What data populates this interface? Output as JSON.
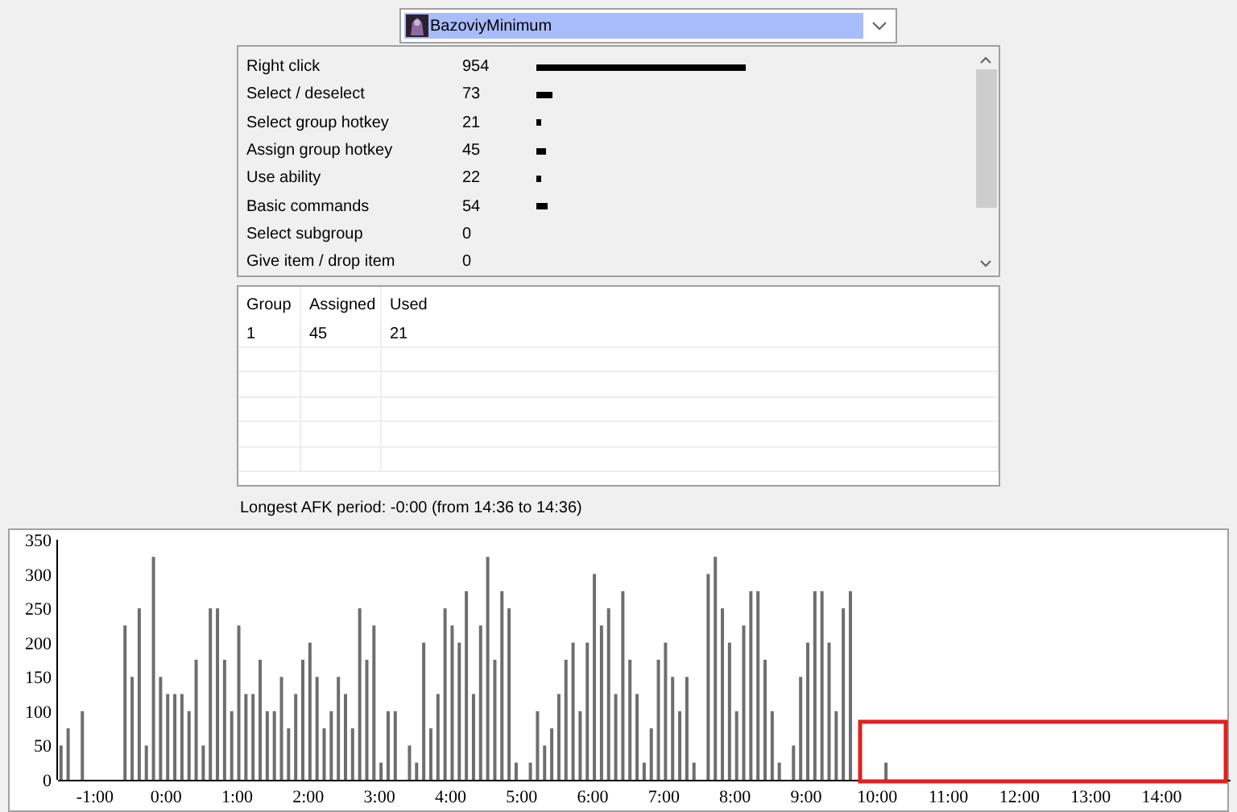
{
  "player_select": {
    "value": "BazoviyMinimum"
  },
  "actions": [
    {
      "label": "Right click",
      "count": "954"
    },
    {
      "label": "Select / deselect",
      "count": "73"
    },
    {
      "label": "Select group hotkey",
      "count": "21"
    },
    {
      "label": "Assign group hotkey",
      "count": "45"
    },
    {
      "label": "Use ability",
      "count": "22"
    },
    {
      "label": "Basic commands",
      "count": "54"
    },
    {
      "label": "Select subgroup",
      "count": "0"
    },
    {
      "label": "Give item / drop item",
      "count": "0"
    }
  ],
  "groups_table": {
    "columns": [
      "Group",
      "Assigned",
      "Used"
    ],
    "rows": [
      [
        "1",
        "45",
        "21"
      ]
    ]
  },
  "afk_text": "Longest AFK period: -0:00 (from 14:36 to 14:36)",
  "activity_chart": {
    "chart_data": {
      "type": "bar",
      "x": [
        -1.5,
        -1.4,
        -1.2,
        -0.6,
        -0.5,
        -0.4,
        -0.3,
        -0.2,
        -0.1,
        0.0,
        0.1,
        0.2,
        0.3,
        0.4,
        0.5,
        0.6,
        0.7,
        0.8,
        0.9,
        1.0,
        1.1,
        1.2,
        1.3,
        1.4,
        1.5,
        1.6,
        1.7,
        1.8,
        1.9,
        2.0,
        2.1,
        2.2,
        2.3,
        2.4,
        2.5,
        2.6,
        2.7,
        2.8,
        2.9,
        3.0,
        3.1,
        3.2,
        3.4,
        3.5,
        3.6,
        3.7,
        3.8,
        3.9,
        4.0,
        4.1,
        4.2,
        4.3,
        4.4,
        4.5,
        4.6,
        4.7,
        4.8,
        4.9,
        5.1,
        5.2,
        5.3,
        5.4,
        5.5,
        5.6,
        5.7,
        5.8,
        5.9,
        6.0,
        6.1,
        6.2,
        6.3,
        6.4,
        6.5,
        6.6,
        6.7,
        6.8,
        6.9,
        7.0,
        7.1,
        7.2,
        7.3,
        7.4,
        7.6,
        7.7,
        7.8,
        7.9,
        8.0,
        8.1,
        8.2,
        8.3,
        8.4,
        8.5,
        8.6,
        8.8,
        8.9,
        9.0,
        9.1,
        9.2,
        9.3,
        9.4,
        9.5,
        9.6,
        10.1
      ],
      "series": [
        {
          "color": "#6e6e6e",
          "values": [
            50,
            75,
            100,
            225,
            150,
            250,
            50,
            325,
            150,
            125,
            125,
            125,
            100,
            175,
            50,
            250,
            250,
            175,
            100,
            225,
            125,
            125,
            175,
            100,
            100,
            150,
            75,
            125,
            175,
            200,
            150,
            75,
            100,
            150,
            125,
            75,
            250,
            175,
            225,
            25,
            100,
            100,
            50,
            25,
            200,
            75,
            125,
            250,
            225,
            200,
            275,
            125,
            225,
            325,
            175,
            275,
            250,
            25,
            25,
            100,
            50,
            75,
            125,
            175,
            200,
            100,
            200,
            300,
            225,
            250,
            125,
            275,
            175,
            125,
            25,
            75,
            175,
            200,
            150,
            100,
            150,
            25,
            300,
            325,
            250,
            200,
            100,
            225,
            275,
            275,
            175,
            100,
            25,
            50,
            150,
            200,
            275,
            275,
            200,
            100,
            250,
            275,
            25
          ]
        }
      ],
      "xlim": [
        -1.52,
        14.9
      ],
      "ylim": [
        0,
        350
      ],
      "xticks": [
        {
          "value": -1,
          "label": "-1:00"
        },
        {
          "value": 0,
          "label": "0:00"
        },
        {
          "value": 1,
          "label": "1:00"
        },
        {
          "value": 2,
          "label": "2:00"
        },
        {
          "value": 3,
          "label": "3:00"
        },
        {
          "value": 4,
          "label": "4:00"
        },
        {
          "value": 5,
          "label": "5:00"
        },
        {
          "value": 6,
          "label": "6:00"
        },
        {
          "value": 7,
          "label": "7:00"
        },
        {
          "value": 8,
          "label": "8:00"
        },
        {
          "value": 9,
          "label": "9:00"
        },
        {
          "value": 10,
          "label": "10:00"
        },
        {
          "value": 11,
          "label": "11:00"
        },
        {
          "value": 12,
          "label": "12:00"
        },
        {
          "value": 13,
          "label": "13:00"
        },
        {
          "value": 14,
          "label": "14:00"
        }
      ],
      "yticks": [
        0,
        50,
        100,
        150,
        200,
        250,
        300,
        350
      ]
    }
  }
}
